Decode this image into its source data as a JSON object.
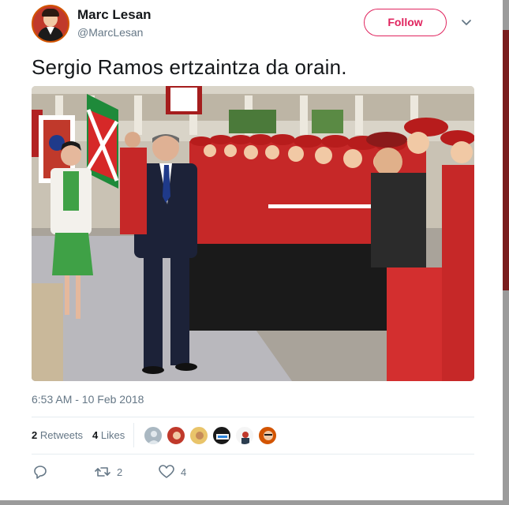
{
  "user": {
    "name": "Marc Lesan",
    "handle": "@MarcLesan"
  },
  "follow_label": "Follow",
  "tweet": {
    "text": "Sergio Ramos ertzaintza da orain.",
    "timestamp": "6:53 AM - 10 Feb 2018"
  },
  "stats": {
    "retweets_count": "2",
    "retweets_label": "Retweets",
    "likes_count": "4",
    "likes_label": "Likes"
  },
  "actions": {
    "retweet_count": "2",
    "like_count": "4"
  },
  "colors": {
    "accent": "#e0245e",
    "muted": "#657786",
    "text": "#14171a"
  },
  "icons": [
    "chevron-down-icon",
    "reply-icon",
    "retweet-icon",
    "heart-icon"
  ]
}
